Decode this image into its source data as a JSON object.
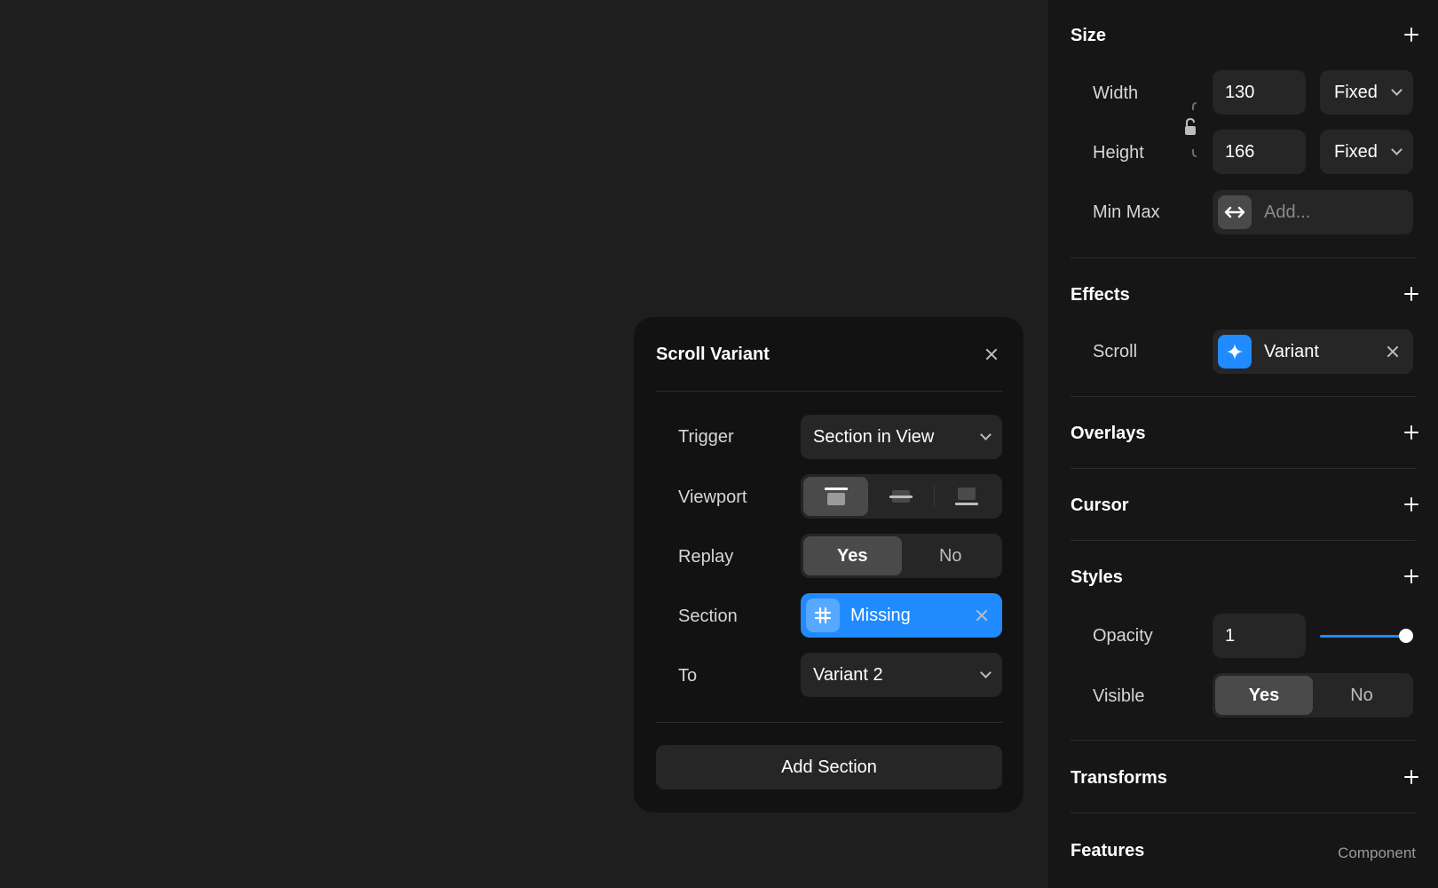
{
  "size": {
    "title": "Size",
    "width_label": "Width",
    "width_value": "130",
    "width_mode": "Fixed",
    "height_label": "Height",
    "height_value": "166",
    "height_mode": "Fixed",
    "minmax_label": "Min Max",
    "minmax_placeholder": "Add..."
  },
  "effects": {
    "title": "Effects",
    "scroll_label": "Scroll",
    "scroll_value": "Variant"
  },
  "overlays": {
    "title": "Overlays"
  },
  "cursor": {
    "title": "Cursor"
  },
  "styles": {
    "title": "Styles",
    "opacity_label": "Opacity",
    "opacity_value": "1",
    "opacity_level": 1.0,
    "visible_label": "Visible",
    "visible_yes": "Yes",
    "visible_no": "No",
    "visible_selected": "Yes"
  },
  "transforms": {
    "title": "Transforms"
  },
  "features": {
    "title": "Features",
    "value": "Component"
  },
  "modal": {
    "title": "Scroll Variant",
    "trigger_label": "Trigger",
    "trigger_value": "Section in View",
    "viewport_label": "Viewport",
    "viewport_options": [
      "top",
      "center",
      "bottom"
    ],
    "viewport_selected": "top",
    "replay_label": "Replay",
    "replay_yes": "Yes",
    "replay_no": "No",
    "replay_selected": "Yes",
    "section_label": "Section",
    "section_value": "Missing",
    "to_label": "To",
    "to_value": "Variant 2",
    "add_button": "Add Section"
  },
  "colors": {
    "canvas": "#1e1e1e",
    "panel": "#161616",
    "accent": "#1f8bff",
    "field": "#262626"
  },
  "icons": {
    "plus": "plus-icon",
    "chevron": "chevron-down-icon",
    "lock": "aspect-lock-icon",
    "minmax": "arrows-horizontal-icon",
    "scroll_effect": "sparkle-icon",
    "section": "frame-hash-icon",
    "close": "close-icon"
  }
}
